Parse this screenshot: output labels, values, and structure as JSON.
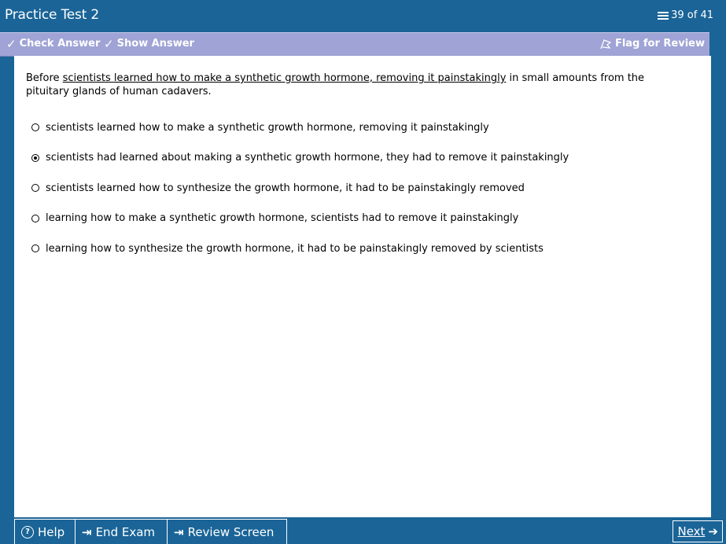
{
  "window": {
    "title": "Practice Test 2",
    "counter": "39 of 41"
  },
  "toolbar": {
    "check_answer": "Check Answer",
    "show_answer": "Show Answer",
    "flag_for_review": "Flag for Review"
  },
  "question": {
    "before": "Before ",
    "underlined": "scientists learned how to make a synthetic growth hormone, removing it painstakingly",
    "after": " in small amounts from the pituitary glands of human cadavers."
  },
  "options": [
    {
      "label": "scientists learned how to make a synthetic growth hormone, removing it painstakingly",
      "selected": false
    },
    {
      "label": "scientists had learned about making a synthetic growth hormone, they had to remove it painstakingly",
      "selected": true
    },
    {
      "label": "scientists learned how to synthesize the growth hormone, it had to be painstakingly removed",
      "selected": false
    },
    {
      "label": "learning how to make a synthetic growth hormone, scientists had to remove it painstakingly",
      "selected": false
    },
    {
      "label": "learning how to synthesize the growth hormone, it had to be painstakingly removed by scientists",
      "selected": false
    }
  ],
  "bottombar": {
    "help": "Help",
    "end_exam": "End Exam",
    "review_screen": "Review Screen",
    "next": "Next"
  },
  "colors": {
    "frame": "#1a6497",
    "toolbar": "#9fa3d5",
    "content": "#ffffff"
  },
  "icons": {
    "counter": "list-icon",
    "check_answer": "check-answer-icon",
    "show_answer": "show-answer-icon",
    "flag": "flag-icon",
    "help": "help-circle-icon",
    "end_exam": "end-exam-icon",
    "review_screen": "review-arrow-icon",
    "next": "arrow-right-icon"
  }
}
